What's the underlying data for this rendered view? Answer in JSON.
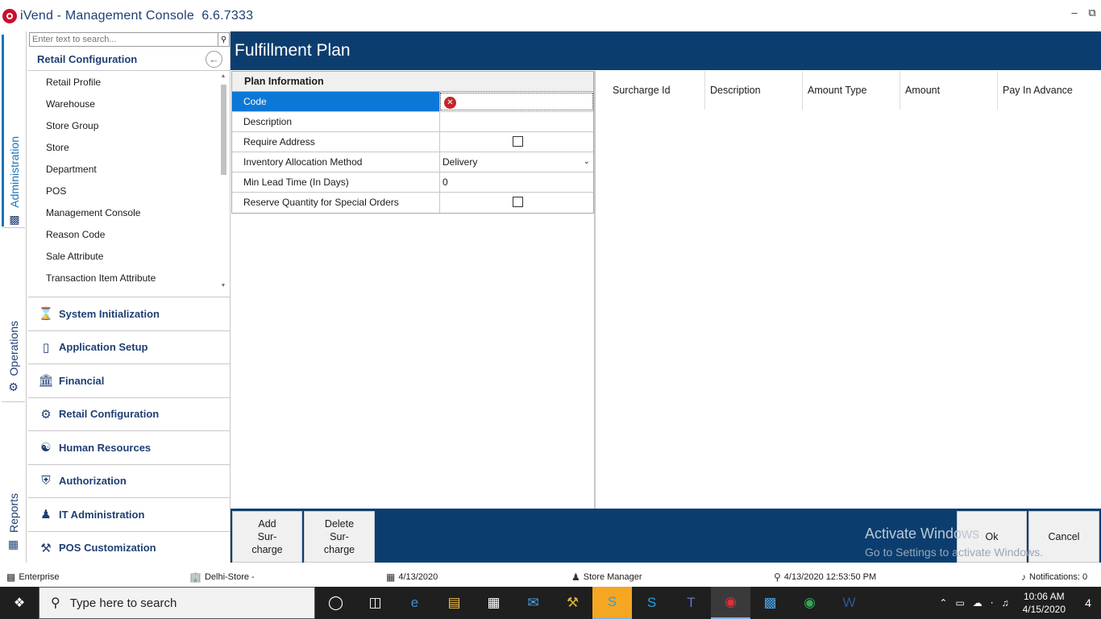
{
  "window": {
    "title": "iVend - Management Console",
    "version": "6.6.7333",
    "controls": [
      "minimize",
      "restore"
    ]
  },
  "vertical_tabs": [
    {
      "label": "Administration",
      "icon": "building-icon",
      "active": true
    },
    {
      "label": "Operations",
      "icon": "gear-icon",
      "active": false
    },
    {
      "label": "Reports",
      "icon": "report-icon",
      "active": false
    }
  ],
  "nav": {
    "search_placeholder": "Enter text to search...",
    "section_title": "Retail Configuration",
    "subitems": [
      "Retail Profile",
      "Warehouse",
      "Store Group",
      "Store",
      "Department",
      "POS",
      "Management Console",
      "Reason Code",
      "Sale Attribute",
      "Transaction Item Attribute"
    ],
    "modules": [
      {
        "label": "System Initialization",
        "icon": "hourglass-icon"
      },
      {
        "label": "Application Setup",
        "icon": "terminal-icon"
      },
      {
        "label": "Financial",
        "icon": "bank-icon"
      },
      {
        "label": "Retail Configuration",
        "icon": "gears-icon"
      },
      {
        "label": "Human Resources",
        "icon": "people-search-icon"
      },
      {
        "label": "Authorization",
        "icon": "shield-icon"
      },
      {
        "label": "IT Administration",
        "icon": "admin-user-icon"
      },
      {
        "label": "POS Customization",
        "icon": "pos-custom-icon"
      }
    ]
  },
  "main": {
    "title": "Fulfillment Plan",
    "plan_info": {
      "header": "Plan Information",
      "fields": {
        "code": {
          "label": "Code",
          "value": ""
        },
        "description": {
          "label": "Description",
          "value": ""
        },
        "require_address": {
          "label": "Require Address",
          "checked": false
        },
        "inventory_allocation": {
          "label": "Inventory Allocation Method",
          "value": "Delivery"
        },
        "min_lead_time": {
          "label": "Min Lead Time (In Days)",
          "value": "0"
        },
        "reserve_quantity": {
          "label": "Reserve Quantity for Special Orders",
          "checked": false
        }
      }
    },
    "surcharge_table": {
      "columns": [
        "Surcharge Id",
        "Description",
        "Amount Type",
        "Amount",
        "Pay In Advance"
      ],
      "rows": []
    }
  },
  "bottom_buttons": {
    "add_line1": "Add",
    "add_line2": "Sur-",
    "add_line3": "charge",
    "delete_line1": "Delete",
    "delete_line2": "Sur-",
    "delete_line3": "charge",
    "ok": "Ok",
    "cancel": "Cancel"
  },
  "watermark": {
    "title": "Activate Windows",
    "subtitle": "Go to Settings to activate Windows."
  },
  "status_bar": {
    "enterprise": "Enterprise",
    "store": "Delhi-Store -",
    "date": "4/13/2020",
    "role": "Store Manager",
    "login_time": "4/13/2020 12:53:50 PM",
    "notifications": "Notifications: 0"
  },
  "taskbar": {
    "search_placeholder": "Type here to search",
    "time": "10:06 AM",
    "date": "4/15/2020",
    "notification_count": "4"
  },
  "colors": {
    "header_blue": "#0b3e6f",
    "selected_row": "#0b78d7",
    "nav_text": "#1e3f73",
    "error": "#c1272d"
  }
}
